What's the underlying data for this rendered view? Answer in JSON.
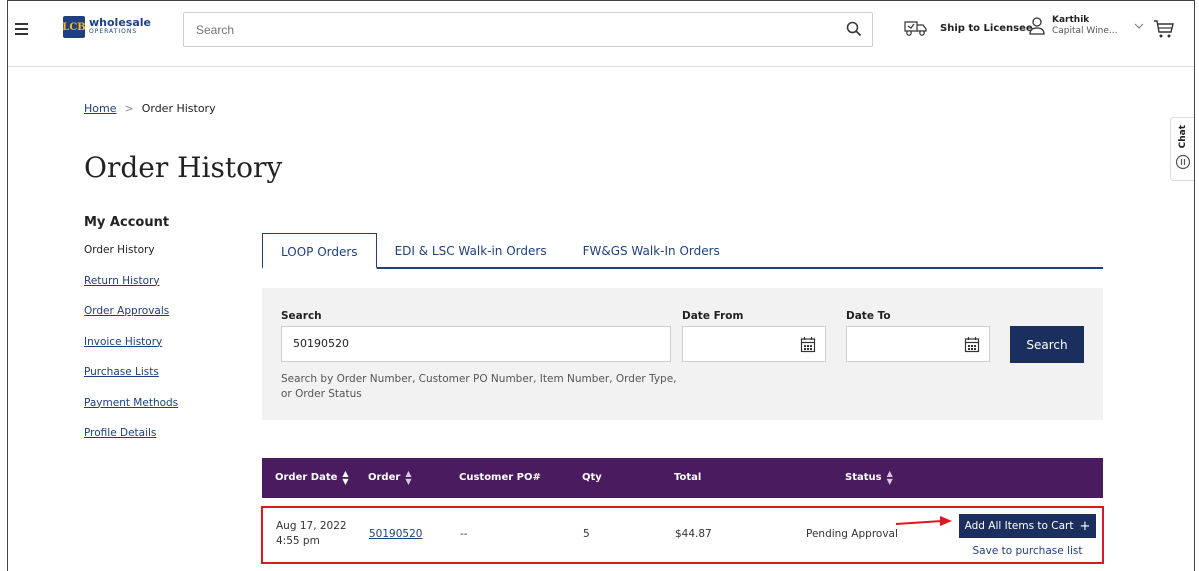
{
  "header": {
    "logo_mark": "LCB",
    "logo_word": "wholesale",
    "logo_sub": "OPERATIONS",
    "search_placeholder": "Search",
    "ship_label": "Ship to Licensee",
    "user_name": "Karthik",
    "user_account": "Capital Wine..."
  },
  "breadcrumb": {
    "home": "Home",
    "separator": ">",
    "current": "Order History"
  },
  "page_title": "Order History",
  "chat_label": "Chat",
  "sidebar": {
    "heading": "My Account",
    "items": [
      {
        "label": "Order History"
      },
      {
        "label": "Return History"
      },
      {
        "label": "Order Approvals"
      },
      {
        "label": "Invoice History"
      },
      {
        "label": "Purchase Lists"
      },
      {
        "label": "Payment Methods"
      },
      {
        "label": "Profile Details"
      }
    ]
  },
  "tabs": [
    {
      "label": "LOOP Orders"
    },
    {
      "label": "EDI & LSC Walk-in Orders"
    },
    {
      "label": "FW&GS Walk-In Orders"
    }
  ],
  "search_panel": {
    "search_label": "Search",
    "search_value": "50190520",
    "help_text": "Search by Order Number, Customer PO Number, Item Number, Order Type, or Order Status",
    "date_from_label": "Date From",
    "date_to_label": "Date To",
    "date_from_value": "",
    "date_to_value": "",
    "search_button": "Search"
  },
  "table": {
    "columns": [
      "Order Date",
      "Order",
      "Customer PO#",
      "Qty",
      "Total",
      "Status"
    ],
    "rows": [
      {
        "date": "Aug 17, 2022",
        "time": "4:55 pm",
        "order": "50190520",
        "po": "--",
        "qty": "5",
        "total": "$44.87",
        "status": "Pending Approval",
        "add_button": "Add All Items to Cart",
        "save_link": "Save to purchase list"
      }
    ]
  },
  "colors": {
    "brand_navy": "#1b2f5e",
    "table_header": "#4a1c5f",
    "highlight_red": "#e0171f",
    "panel_gray": "#f2f2f2"
  }
}
